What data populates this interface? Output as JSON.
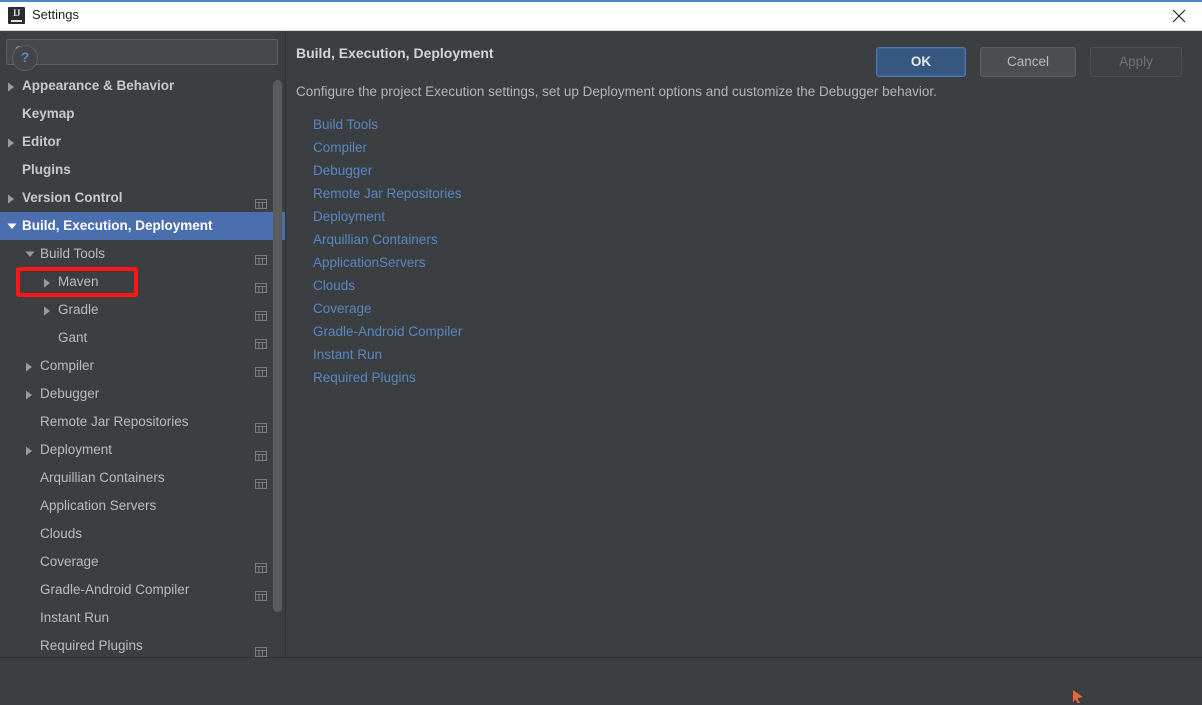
{
  "window": {
    "title": "Settings",
    "app_icon": "intellij-idea-icon",
    "close_icon": "close-icon"
  },
  "search": {
    "value": "",
    "placeholder": "",
    "icon": "search-icon"
  },
  "sidebar": {
    "items": [
      {
        "label": "Appearance & Behavior",
        "indent": 0,
        "arrow": "collapsed",
        "bold": true,
        "scope_icon": false,
        "selected": false
      },
      {
        "label": "Keymap",
        "indent": 0,
        "arrow": "none",
        "bold": true,
        "scope_icon": false,
        "selected": false
      },
      {
        "label": "Editor",
        "indent": 0,
        "arrow": "collapsed",
        "bold": true,
        "scope_icon": false,
        "selected": false
      },
      {
        "label": "Plugins",
        "indent": 0,
        "arrow": "none",
        "bold": true,
        "scope_icon": false,
        "selected": false
      },
      {
        "label": "Version Control",
        "indent": 0,
        "arrow": "collapsed",
        "bold": true,
        "scope_icon": true,
        "selected": false
      },
      {
        "label": "Build, Execution, Deployment",
        "indent": 0,
        "arrow": "expanded",
        "bold": true,
        "scope_icon": false,
        "selected": true
      },
      {
        "label": "Build Tools",
        "indent": 1,
        "arrow": "expanded",
        "bold": false,
        "scope_icon": true,
        "selected": false
      },
      {
        "label": "Maven",
        "indent": 2,
        "arrow": "collapsed",
        "bold": false,
        "scope_icon": true,
        "selected": false
      },
      {
        "label": "Gradle",
        "indent": 2,
        "arrow": "collapsed",
        "bold": false,
        "scope_icon": true,
        "selected": false
      },
      {
        "label": "Gant",
        "indent": 2,
        "arrow": "none",
        "bold": false,
        "scope_icon": true,
        "selected": false
      },
      {
        "label": "Compiler",
        "indent": 1,
        "arrow": "collapsed",
        "bold": false,
        "scope_icon": true,
        "selected": false
      },
      {
        "label": "Debugger",
        "indent": 1,
        "arrow": "collapsed",
        "bold": false,
        "scope_icon": false,
        "selected": false
      },
      {
        "label": "Remote Jar Repositories",
        "indent": 1,
        "arrow": "none",
        "bold": false,
        "scope_icon": true,
        "selected": false
      },
      {
        "label": "Deployment",
        "indent": 1,
        "arrow": "collapsed",
        "bold": false,
        "scope_icon": true,
        "selected": false
      },
      {
        "label": "Arquillian Containers",
        "indent": 1,
        "arrow": "none",
        "bold": false,
        "scope_icon": true,
        "selected": false
      },
      {
        "label": "Application Servers",
        "indent": 1,
        "arrow": "none",
        "bold": false,
        "scope_icon": false,
        "selected": false
      },
      {
        "label": "Clouds",
        "indent": 1,
        "arrow": "none",
        "bold": false,
        "scope_icon": false,
        "selected": false
      },
      {
        "label": "Coverage",
        "indent": 1,
        "arrow": "none",
        "bold": false,
        "scope_icon": true,
        "selected": false
      },
      {
        "label": "Gradle-Android Compiler",
        "indent": 1,
        "arrow": "none",
        "bold": false,
        "scope_icon": true,
        "selected": false
      },
      {
        "label": "Instant Run",
        "indent": 1,
        "arrow": "none",
        "bold": false,
        "scope_icon": false,
        "selected": false
      },
      {
        "label": "Required Plugins",
        "indent": 1,
        "arrow": "none",
        "bold": false,
        "scope_icon": true,
        "selected": false
      }
    ],
    "annotation": {
      "target_label": "Maven",
      "color": "#fe1616"
    }
  },
  "main": {
    "title": "Build, Execution, Deployment",
    "description": "Configure the project Execution settings, set up Deployment options and customize the Debugger behavior.",
    "links": [
      "Build Tools",
      "Compiler",
      "Debugger",
      "Remote Jar Repositories",
      "Deployment",
      "Arquillian Containers",
      "ApplicationServers",
      "Clouds",
      "Coverage",
      "Gradle-Android Compiler",
      "Instant Run",
      "Required Plugins"
    ]
  },
  "footer": {
    "help_label": "?",
    "ok_label": "OK",
    "cancel_label": "Cancel",
    "apply_label": "Apply"
  },
  "colors": {
    "background": "#3c3f41",
    "selection": "#4b6eaf",
    "link": "#5a86c4",
    "default_button": "#365880",
    "annotation": "#fe1616",
    "titlebar": "#ffffff"
  }
}
